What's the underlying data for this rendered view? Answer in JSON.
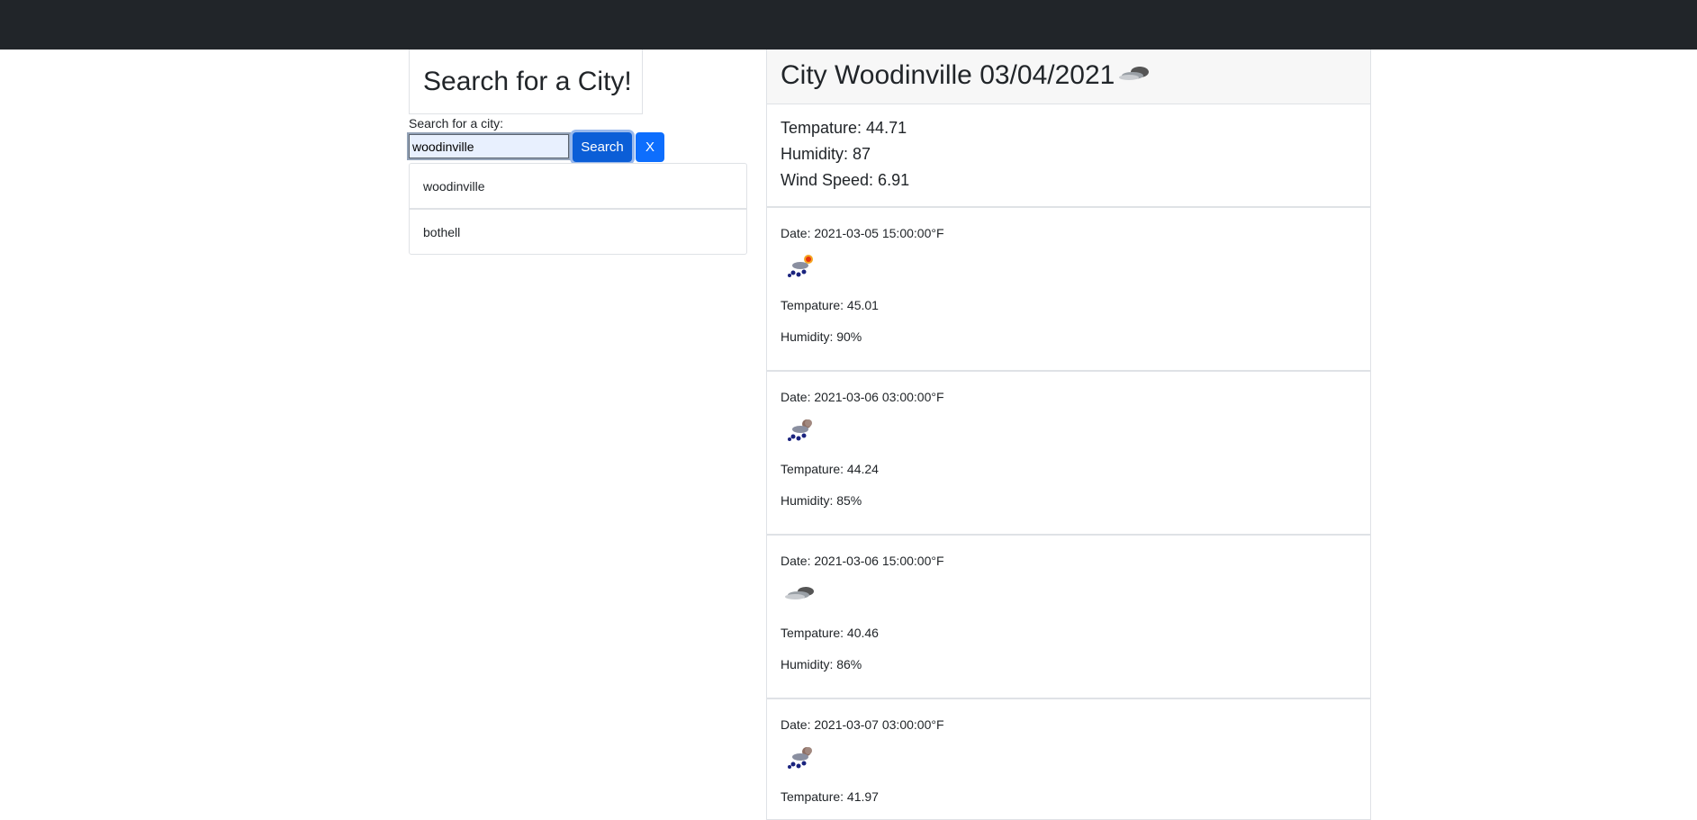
{
  "search": {
    "title": "Search for a City!",
    "label": "Search for a city:",
    "input_value": "woodinville",
    "search_button": "Search",
    "clear_button": "X"
  },
  "history": [
    "woodinville",
    "bothell"
  ],
  "current": {
    "heading": "City Woodinville 03/04/2021",
    "icon": "cloud-icon",
    "temperature": "Tempature: 44.71",
    "humidity": "Humidity: 87",
    "wind": "Wind Speed: 6.91"
  },
  "forecast": [
    {
      "date": "Date: 2021-03-05 15:00:00°F",
      "icon": "sun-rain-icon",
      "temperature": "Tempature: 45.01",
      "humidity": "Humidity: 90%"
    },
    {
      "date": "Date: 2021-03-06 03:00:00°F",
      "icon": "night-rain-icon",
      "temperature": "Tempature: 44.24",
      "humidity": "Humidity: 85%"
    },
    {
      "date": "Date: 2021-03-06 15:00:00°F",
      "icon": "cloud-icon",
      "temperature": "Tempature: 40.46",
      "humidity": "Humidity: 86%"
    },
    {
      "date": "Date: 2021-03-07 03:00:00°F",
      "icon": "night-rain-icon",
      "temperature": "Tempature: 41.97",
      "humidity": ""
    }
  ]
}
